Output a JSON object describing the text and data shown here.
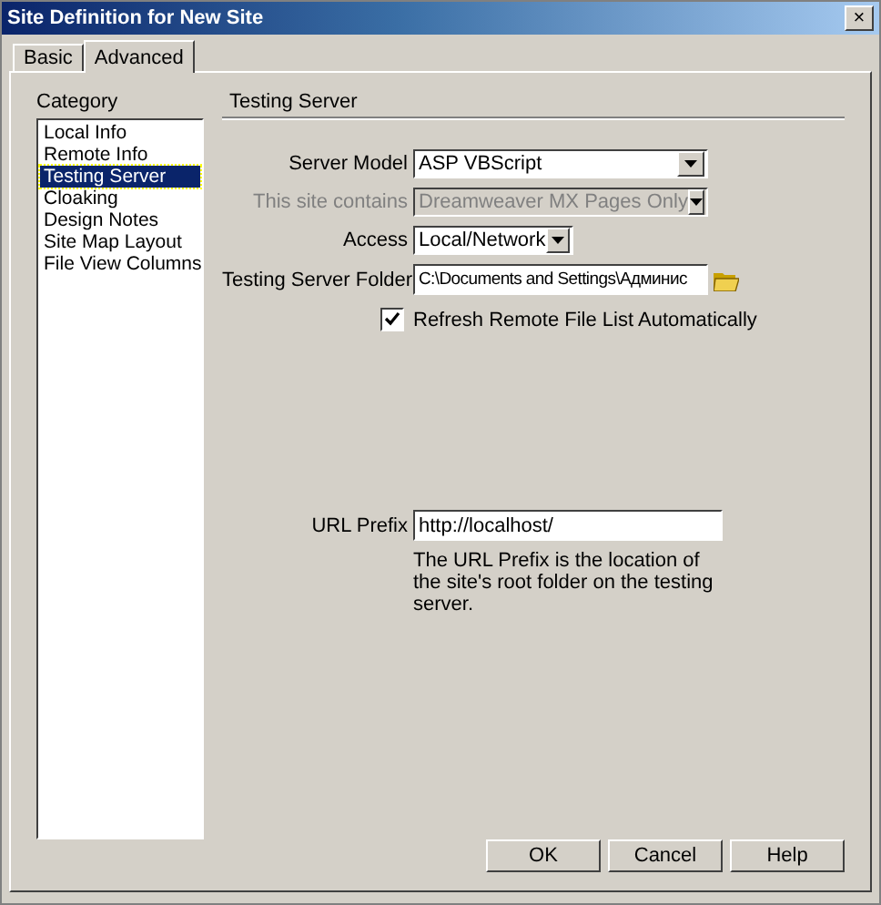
{
  "window": {
    "title": "Site Definition for New Site",
    "close": "×"
  },
  "tabs": [
    {
      "label": "Basic",
      "selected": false
    },
    {
      "label": "Advanced",
      "selected": true
    }
  ],
  "category": {
    "label": "Category",
    "items": [
      {
        "label": "Local Info",
        "selected": false
      },
      {
        "label": "Remote Info",
        "selected": false
      },
      {
        "label": "Testing Server",
        "selected": true
      },
      {
        "label": "Cloaking",
        "selected": false
      },
      {
        "label": "Design Notes",
        "selected": false
      },
      {
        "label": "Site Map Layout",
        "selected": false
      },
      {
        "label": "File View Columns",
        "selected": false
      }
    ]
  },
  "section": {
    "title": "Testing Server"
  },
  "fields": [
    {
      "kind": "select",
      "label": "Server Model",
      "value": "ASP VBScript",
      "disabled": false,
      "wide": true
    },
    {
      "kind": "select",
      "label": "This site contains",
      "value": "Dreamweaver MX Pages Only",
      "disabled": true,
      "wide": true
    },
    {
      "kind": "select",
      "label": "Access",
      "value": "Local/Network",
      "disabled": false,
      "wide": false
    },
    {
      "kind": "folder",
      "label": "Testing Server Folder",
      "value": "C:\\Documents and Settings\\Админис",
      "wide": true
    }
  ],
  "refresh": {
    "label": "Refresh Remote File List Automatically",
    "checked": true
  },
  "url_prefix": {
    "label": "URL Prefix",
    "value": "http://localhost/",
    "hint": "The URL Prefix is the location of the site's root folder on the testing server."
  },
  "buttons": [
    "OK",
    "Cancel",
    "Help"
  ]
}
